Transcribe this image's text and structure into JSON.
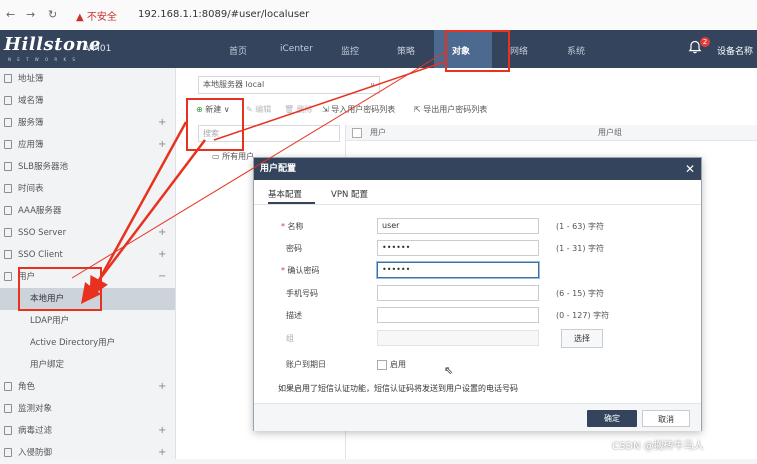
{
  "browser": {
    "warning": "不安全",
    "url": "192.168.1.1:8089/#user/localuser"
  },
  "header": {
    "logo": "Hillstone",
    "logo_sub": "N E T W O R K S",
    "device": "VM01",
    "tabs": [
      "首页",
      "iCenter",
      "监控",
      "策略",
      "对象",
      "网络",
      "系统"
    ],
    "active_tab": "对象",
    "notification_count": "2",
    "device_name_label": "设备名称"
  },
  "sidebar": {
    "items": [
      {
        "label": "地址簿",
        "expand": ""
      },
      {
        "label": "域名簿",
        "expand": ""
      },
      {
        "label": "服务簿",
        "expand": "+"
      },
      {
        "label": "应用簿",
        "expand": "+"
      },
      {
        "label": "SLB服务器池",
        "expand": ""
      },
      {
        "label": "时间表",
        "expand": ""
      },
      {
        "label": "AAA服务器",
        "expand": ""
      },
      {
        "label": "SSO Server",
        "expand": "+"
      },
      {
        "label": "SSO Client",
        "expand": "+"
      },
      {
        "label": "用户",
        "expand": "−"
      },
      {
        "label": "本地用户",
        "expand": ""
      },
      {
        "label": "LDAP用户",
        "expand": ""
      },
      {
        "label": "Active Directory用户",
        "expand": ""
      },
      {
        "label": "用户绑定",
        "expand": ""
      },
      {
        "label": "角色",
        "expand": "+"
      },
      {
        "label": "监测对象",
        "expand": ""
      },
      {
        "label": "病毒过滤",
        "expand": "+"
      },
      {
        "label": "入侵防御",
        "expand": "+"
      }
    ]
  },
  "main": {
    "server_select": "本地服务器 local",
    "toolbar": {
      "new": "新建",
      "edit": "编辑",
      "delete": "删除",
      "import": "导入用户密码列表",
      "export": "导出用户密码列表"
    },
    "search_placeholder": "搜索",
    "tree_root": "所有用户",
    "columns": [
      "用户",
      "用户组"
    ]
  },
  "dialog": {
    "title": "用户配置",
    "tabs": [
      "基本配置",
      "VPN 配置"
    ],
    "fields": {
      "name": {
        "label": "名称",
        "value": "user",
        "hint": "(1 - 63) 字符"
      },
      "password": {
        "label": "密码",
        "value": "••••••",
        "hint": "(1 - 31) 字符"
      },
      "confirm": {
        "label": "确认密码",
        "value": "••••••"
      },
      "phone": {
        "label": "手机号码",
        "value": "",
        "hint": "(6 - 15) 字符"
      },
      "desc": {
        "label": "描述",
        "value": "",
        "hint": "(0 - 127) 字符"
      },
      "group": {
        "label": "组",
        "value": ""
      },
      "expire": {
        "label": "账户到期日"
      }
    },
    "choose_label": "选择",
    "enable_label": "启用",
    "note": "如果启用了短信认证功能，短信认证码将发送到用户设置的电话号码",
    "ok_label": "确定",
    "cancel_label": "取消"
  },
  "watermark": "CSDN @搬砖牛马人",
  "colors": {
    "header_bg": "#33445c",
    "annotation_red": "#e8321f",
    "sidebar_selected": "#cdd3da"
  }
}
